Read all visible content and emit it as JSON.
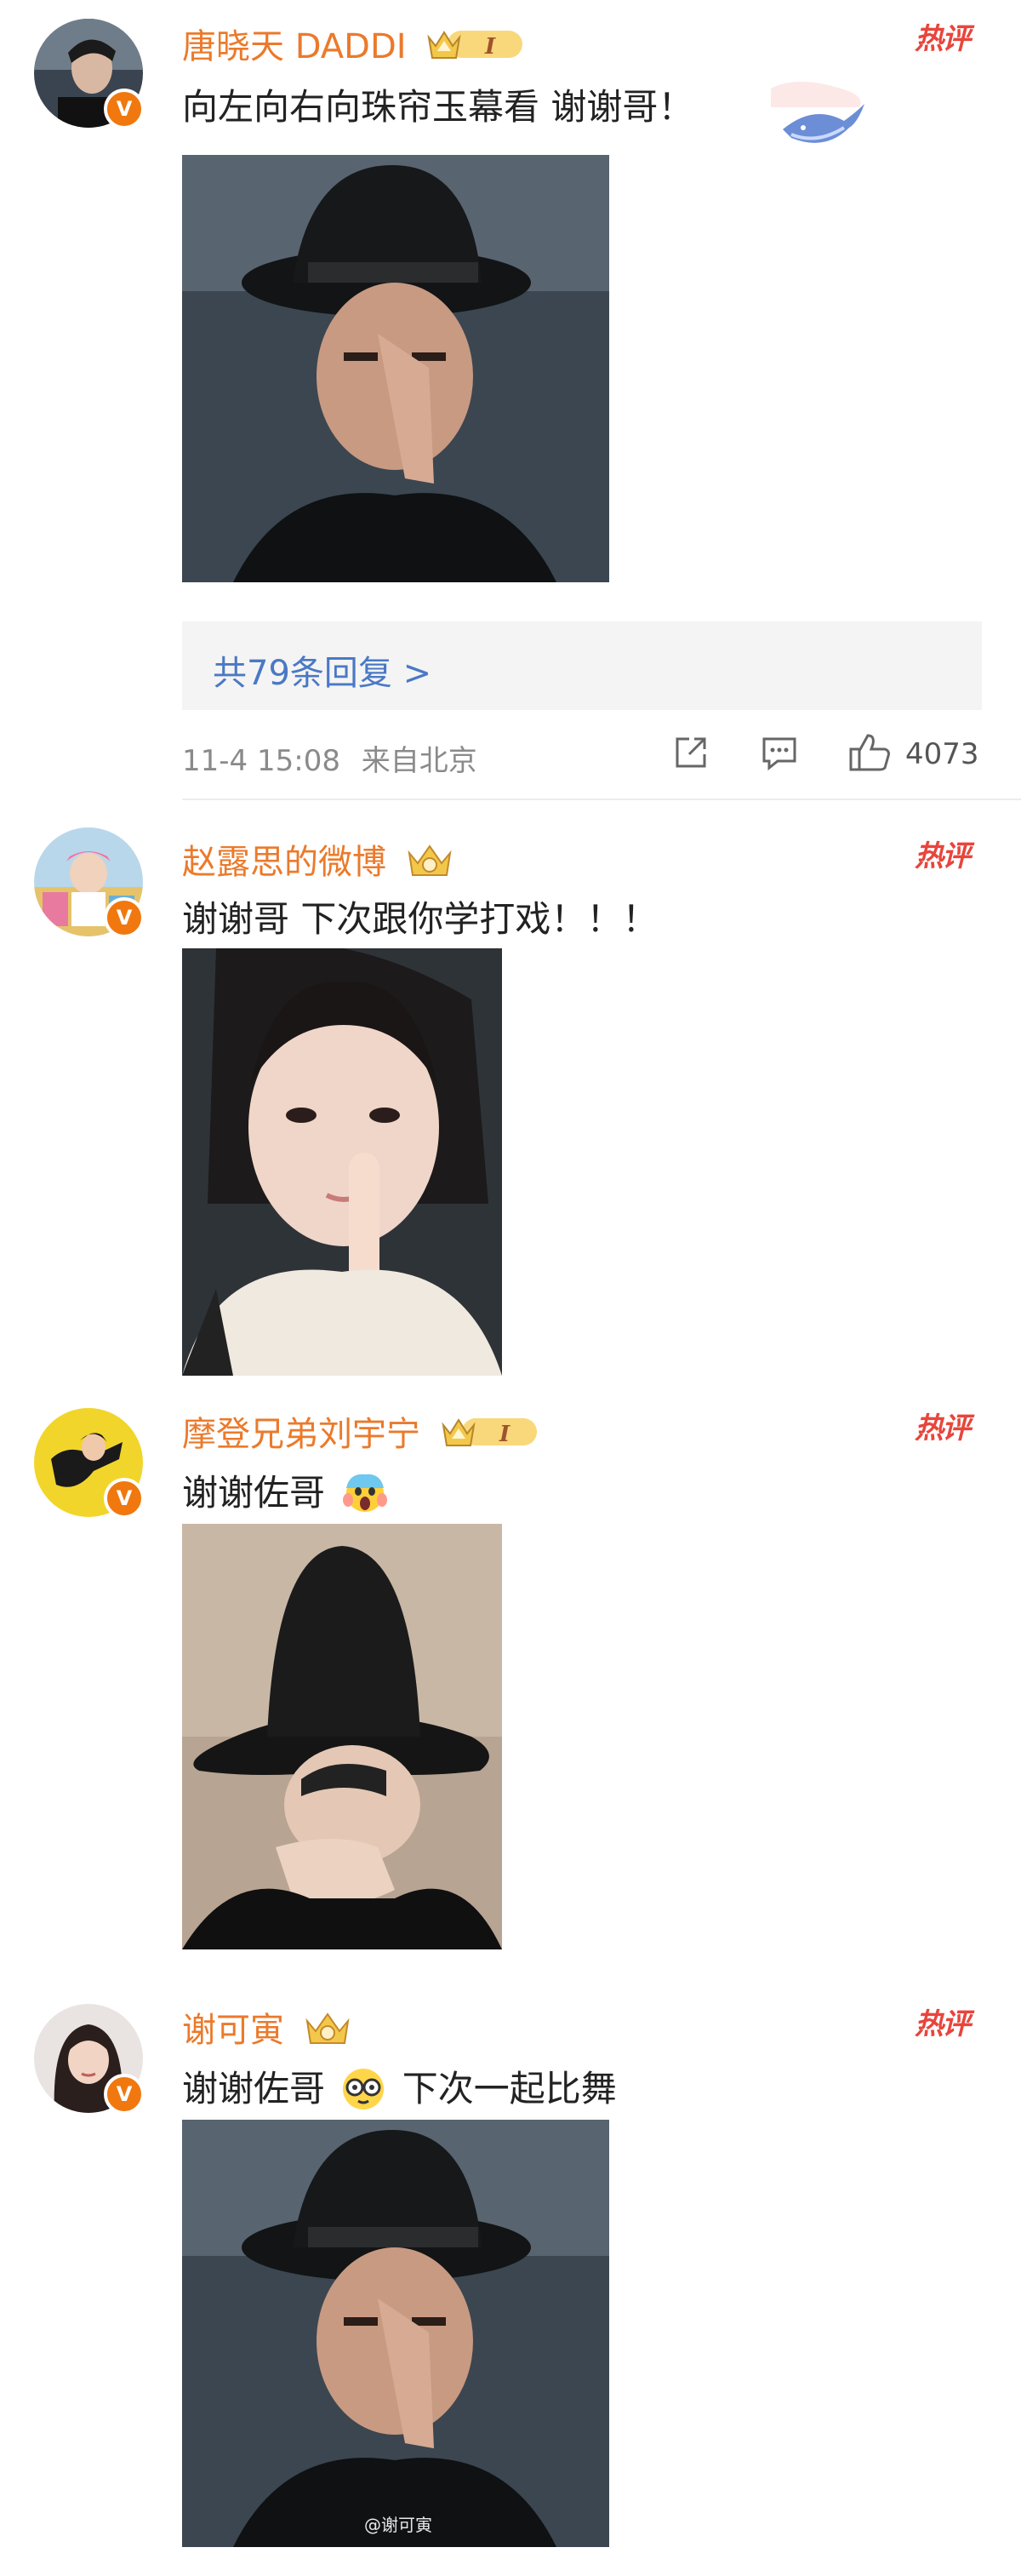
{
  "comments": [
    {
      "username": "唐晓天 DADDI",
      "level_badge": "I",
      "hot_label": "热评",
      "text": "向左向右向珠帘玉幕看 谢谢哥！",
      "replies_label": "共79条回复 >",
      "time": "11-4 15:08",
      "location": "来自北京",
      "likes": "4073",
      "icons": [
        "share-icon",
        "comment-icon",
        "like-icon"
      ]
    },
    {
      "username": "赵露思的微博",
      "hot_label": "热评",
      "text": "谢谢哥 下次跟你学打戏！！！"
    },
    {
      "username": "摩登兄弟刘宇宁",
      "level_badge": "I",
      "hot_label": "热评",
      "text": "谢谢佐哥",
      "emoji": "scream-emoji"
    },
    {
      "username": "谢可寅",
      "hot_label": "热评",
      "text_before": "谢谢佐哥",
      "text_after": "下次一起比舞",
      "emoji": "glasses-emoji",
      "watermark": "@谢可寅"
    }
  ],
  "colors": {
    "username": "#eb7a2b",
    "hot": "#e8453c",
    "link": "#4a79c4",
    "verified": "#f0780f"
  }
}
